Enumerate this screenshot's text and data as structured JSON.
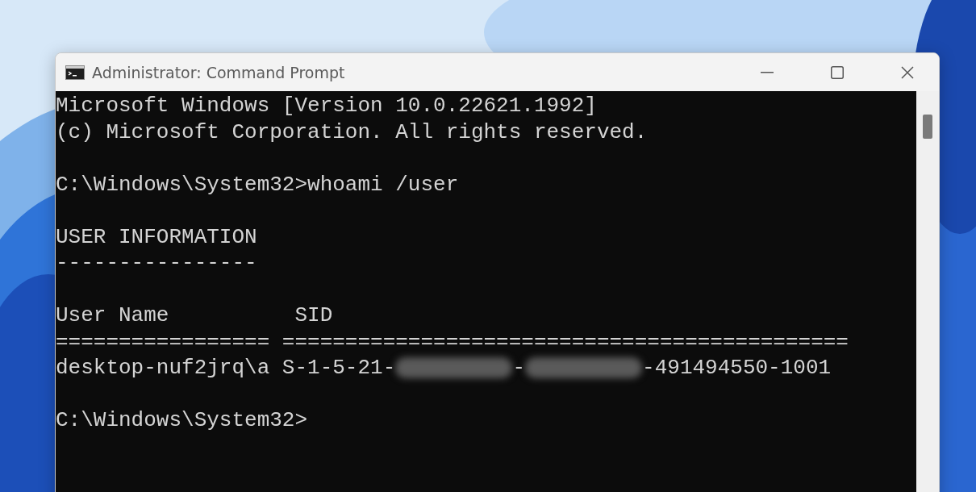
{
  "window": {
    "title": "Administrator: Command Prompt"
  },
  "console": {
    "lines": [
      {
        "kind": "text",
        "segments": [
          {
            "kind": "text",
            "text": "Microsoft Windows [Version 10.0.22621.1992]"
          }
        ]
      },
      {
        "kind": "text",
        "segments": [
          {
            "kind": "text",
            "text": "(c) Microsoft Corporation. All rights reserved."
          }
        ]
      },
      {
        "kind": "blank"
      },
      {
        "kind": "text",
        "segments": [
          {
            "kind": "text",
            "text": "C:\\Windows\\System32>whoami /user"
          }
        ]
      },
      {
        "kind": "blank"
      },
      {
        "kind": "text",
        "segments": [
          {
            "kind": "text",
            "text": "USER INFORMATION"
          }
        ]
      },
      {
        "kind": "text",
        "segments": [
          {
            "kind": "text",
            "text": "----------------"
          }
        ]
      },
      {
        "kind": "blank"
      },
      {
        "kind": "text",
        "segments": [
          {
            "kind": "text",
            "text": "User Name          SID"
          }
        ]
      },
      {
        "kind": "text",
        "segments": [
          {
            "kind": "text",
            "text": "================= ============================================="
          }
        ]
      },
      {
        "kind": "text",
        "segments": [
          {
            "kind": "text",
            "text": "desktop-nuf2jrq\\a S-1-5-21-"
          },
          {
            "kind": "redacted"
          },
          {
            "kind": "text",
            "text": "-"
          },
          {
            "kind": "redacted"
          },
          {
            "kind": "text",
            "text": "-491494550-1001"
          }
        ]
      },
      {
        "kind": "blank"
      },
      {
        "kind": "text",
        "segments": [
          {
            "kind": "text",
            "text": "C:\\Windows\\System32>"
          }
        ]
      }
    ]
  }
}
